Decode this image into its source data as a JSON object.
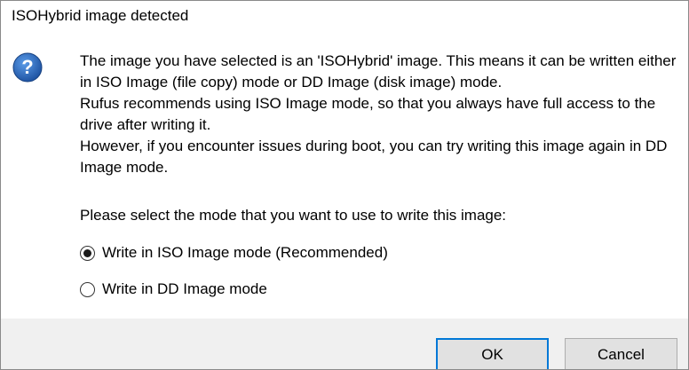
{
  "dialog": {
    "title": "ISOHybrid image detected",
    "icon": "question-icon",
    "message_lines": [
      "The image you have selected is an 'ISOHybrid' image. This means it can be written either in ISO Image (file copy) mode or DD Image (disk image) mode.",
      "Rufus recommends using ISO Image mode, so that you always have full access to the drive after writing it.",
      "However, if you encounter issues during boot, you can try writing this image again in DD Image mode."
    ],
    "prompt": "Please select the mode that you want to use to write this image:",
    "options": [
      {
        "label": "Write in ISO Image mode (Recommended)",
        "selected": true
      },
      {
        "label": "Write in DD Image mode",
        "selected": false
      }
    ],
    "buttons": {
      "ok_label": "OK",
      "cancel_label": "Cancel"
    }
  },
  "colors": {
    "icon_blue": "#1f5fbf",
    "focus_border": "#0078d7",
    "footer_bg": "#f0f0f0",
    "button_bg": "#e1e1e1"
  }
}
